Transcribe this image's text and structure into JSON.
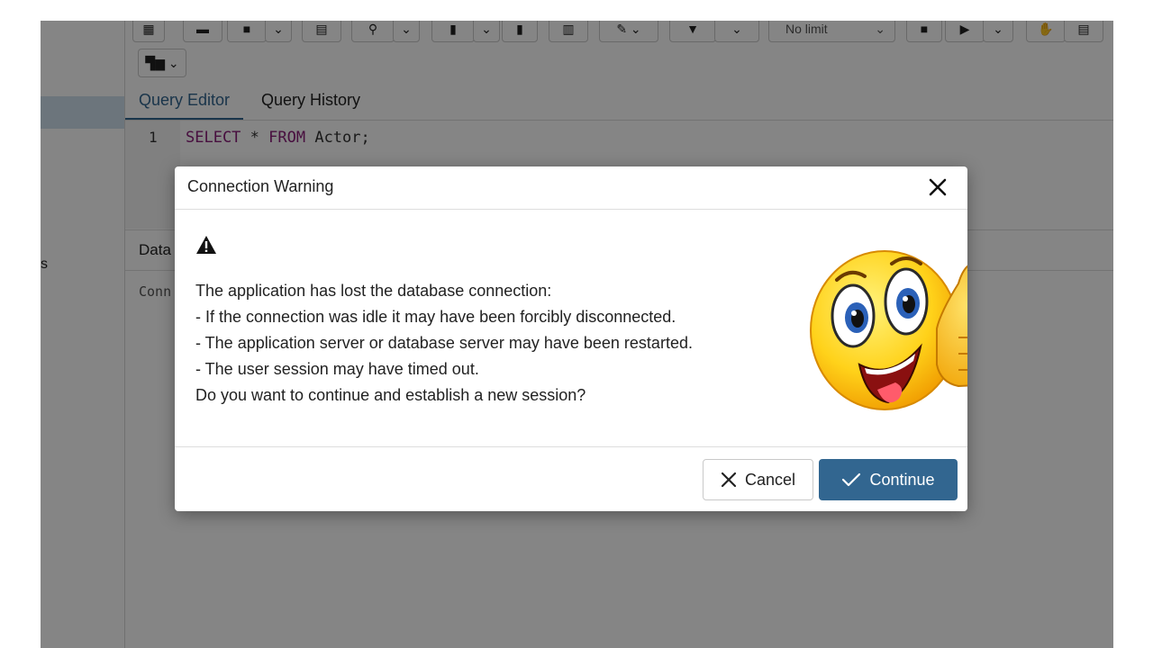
{
  "sidebar": {
    "partial_text": "s"
  },
  "toolbar": {
    "limit_select": "No limit"
  },
  "tabs": [
    {
      "label": "Query Editor",
      "active": true
    },
    {
      "label": "Query History",
      "active": false
    }
  ],
  "editor": {
    "line_number": "1",
    "keyword_select": "SELECT",
    "star": " * ",
    "keyword_from": "FROM",
    "table": " Actor;"
  },
  "lower_panel": {
    "tab_label": "Data",
    "content": "Conn"
  },
  "dialog": {
    "title": "Connection Warning",
    "message": [
      "The application has lost the database connection:",
      "- If the connection was idle it may have been forcibly disconnected.",
      "- The application server or database server may have been restarted.",
      "- The user session may have timed out.",
      "Do you want to continue and establish a new session?"
    ],
    "cancel_label": "Cancel",
    "continue_label": "Continue"
  },
  "colors": {
    "accent": "#326690",
    "overlay": "rgba(0,0,0,0.48)"
  },
  "icons": [
    "warning-icon",
    "close-icon",
    "check-icon",
    "thumbs-up-emoji"
  ]
}
